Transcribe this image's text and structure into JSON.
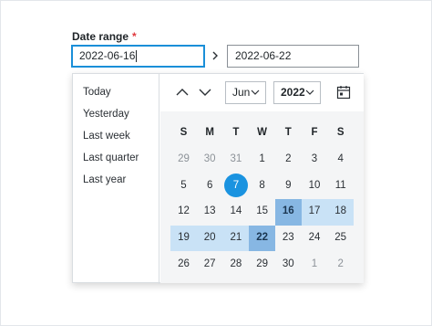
{
  "field": {
    "label": "Date range",
    "required_mark": "*",
    "from_value": "2022-06-16",
    "to_value": "2022-06-22"
  },
  "presets": [
    "Today",
    "Yesterday",
    "Last week",
    "Last quarter",
    "Last year"
  ],
  "calendar": {
    "month": "Jun",
    "year": "2022",
    "weekdays": [
      "S",
      "M",
      "T",
      "W",
      "T",
      "F",
      "S"
    ],
    "weeks": [
      [
        "29",
        "30",
        "31",
        "1",
        "2",
        "3",
        "4"
      ],
      [
        "5",
        "6",
        "7",
        "8",
        "9",
        "10",
        "11"
      ],
      [
        "12",
        "13",
        "14",
        "15",
        "16",
        "17",
        "18"
      ],
      [
        "19",
        "20",
        "21",
        "22",
        "23",
        "24",
        "25"
      ],
      [
        "26",
        "27",
        "28",
        "29",
        "30",
        "1",
        "2"
      ]
    ],
    "today": "7",
    "range_start": "16",
    "range_end": "22"
  },
  "colors": {
    "accent": "#1a93e0",
    "range": "#c9e2f6",
    "range_endpoint": "#87b7e3",
    "required": "#e0393e"
  },
  "icons": {
    "prev": "chevron-up-icon",
    "next": "chevron-down-icon",
    "calendar": "calendar-icon",
    "separator": "chevron-right-icon"
  }
}
